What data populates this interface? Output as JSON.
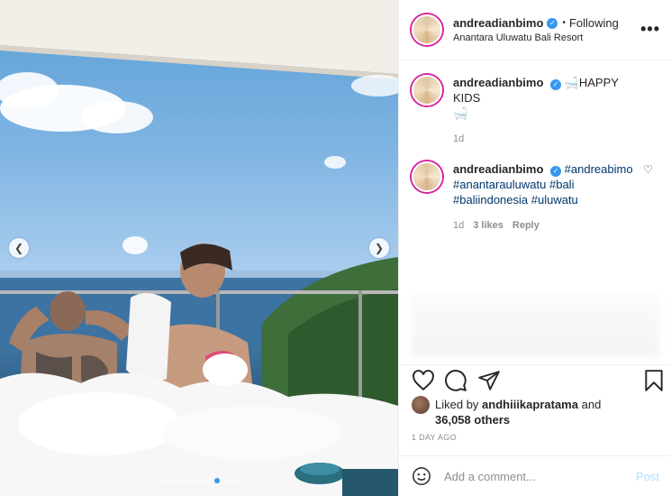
{
  "post": {
    "username": "andreadianbimo",
    "verified": true,
    "separator": "•",
    "follow_status": "Following",
    "location": "Anantara Uluwatu Bali Resort",
    "more_symbol": "•••"
  },
  "caption": {
    "username": "andreadianbimo",
    "bath_emoji": "🛁",
    "text": "HAPPY KIDS",
    "age": "1d"
  },
  "comments": [
    {
      "username": "andreadianbimo",
      "hashtags": [
        "#andreabimo",
        "#anantarauluwatu",
        "#bali",
        "#baliindonesia",
        "#uluwatu"
      ],
      "age": "1d",
      "likes": "3 likes",
      "reply_label": "Reply"
    }
  ],
  "engagement": {
    "liked_by_prefix": "Liked by",
    "liked_by_user": "andhiiikapratama",
    "and_word": "and",
    "others": "36,058 others",
    "timestamp": "1 DAY AGO"
  },
  "composer": {
    "placeholder": "Add a comment...",
    "post_label": "Post"
  },
  "icons": {
    "verified": "verified-badge-icon",
    "heart": "heart-icon",
    "comment": "comment-bubble-icon",
    "share": "paper-plane-icon",
    "save": "bookmark-icon",
    "emoji": "smiley-icon",
    "prev": "chevron-left-icon",
    "next": "chevron-right-icon"
  },
  "carousel": {
    "slides": 9,
    "active_index": 6
  },
  "colors": {
    "link": "#00376b",
    "accent": "#3897f0",
    "post_disabled": "#b2dffc",
    "muted": "#8e8e8e"
  }
}
